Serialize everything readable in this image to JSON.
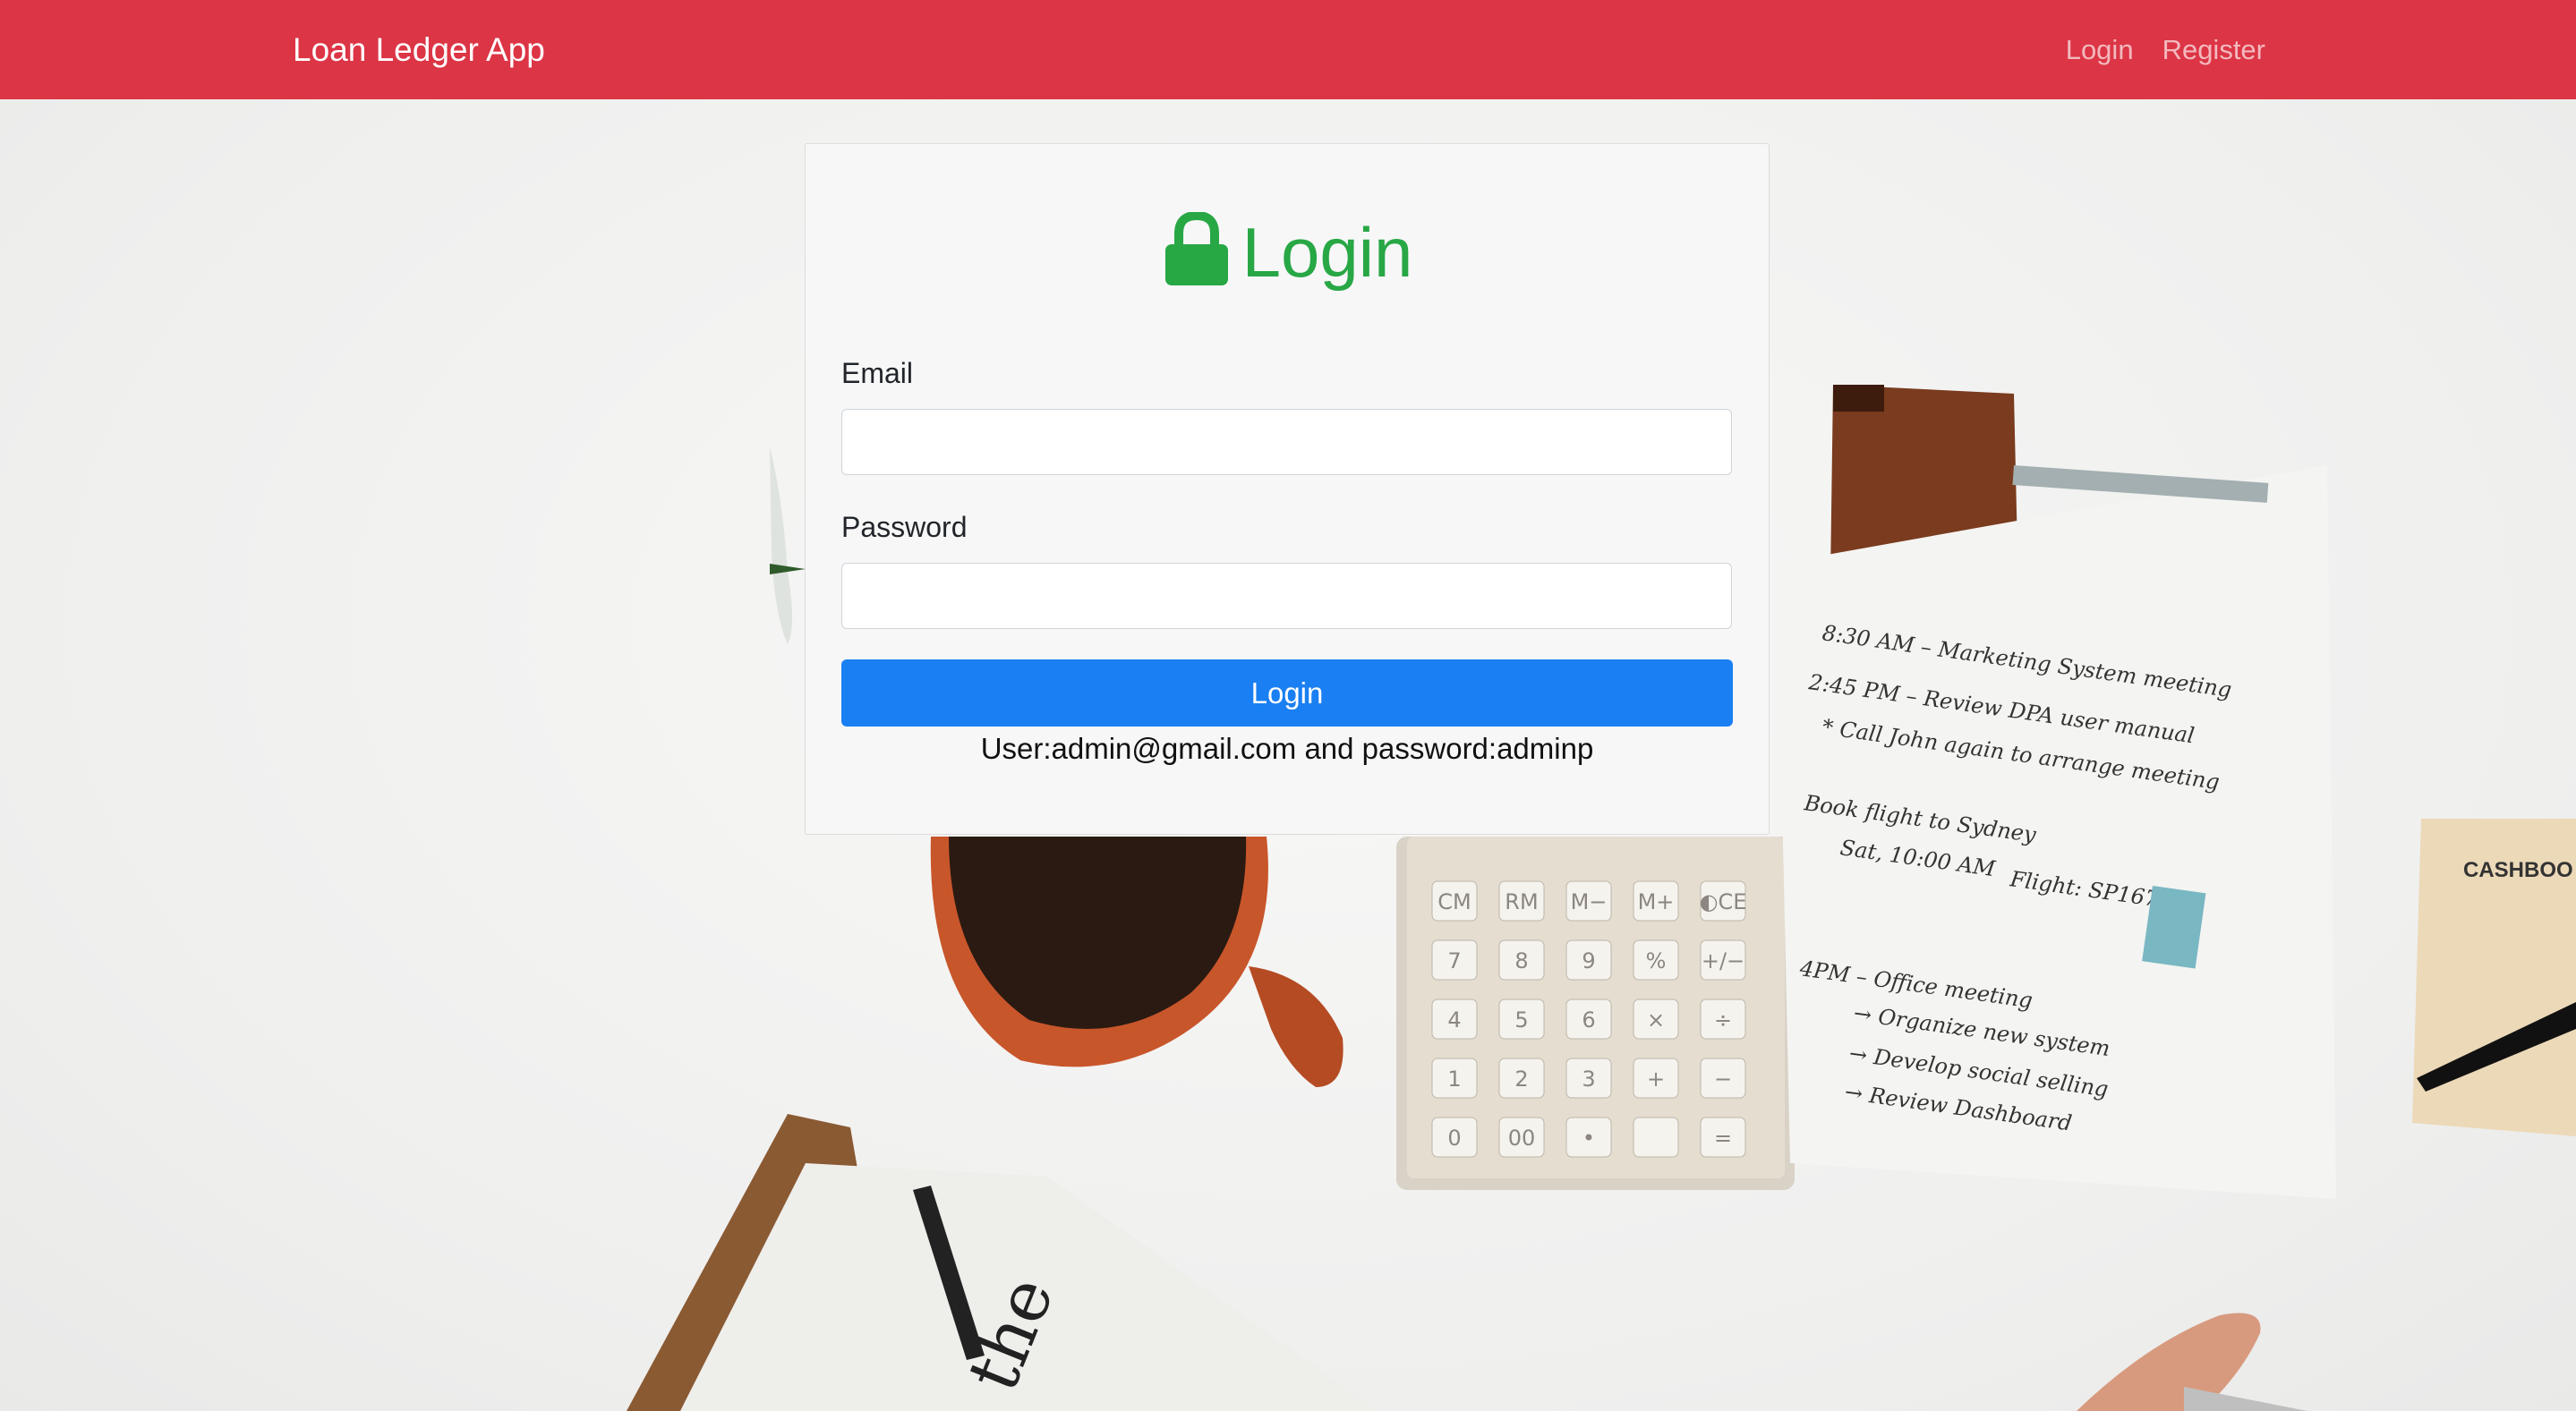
{
  "navbar": {
    "brand": "Loan Ledger App",
    "links": [
      {
        "label": "Login"
      },
      {
        "label": "Register"
      }
    ],
    "color": "#dc3545"
  },
  "login_card": {
    "title": "Login",
    "title_icon": "lock-icon",
    "title_color": "#28a745",
    "email": {
      "label": "Email",
      "value": "",
      "placeholder": ""
    },
    "password": {
      "label": "Password",
      "value": "",
      "placeholder": ""
    },
    "submit_label": "Login",
    "submit_color": "#1a7ff2",
    "hint": "User:admin@gmail.com and password:adminp"
  },
  "background": {
    "calculator_keys": [
      [
        "CM",
        "RM",
        "M−",
        "M+",
        "◐CE"
      ],
      [
        "7",
        "8",
        "9",
        "%",
        "+/−"
      ],
      [
        "4",
        "5",
        "6",
        "×",
        "÷"
      ],
      [
        "1",
        "2",
        "3",
        "+",
        "−"
      ],
      [
        "0",
        "00",
        "•",
        "",
        "="
      ]
    ],
    "notes": [
      "8:30 AM – Marketing System meeting",
      "2:45 PM – Review DPA user manual",
      "* Call John again to arrange meeting",
      "Book flight to Sydney",
      "Sat, 10:00 AM",
      "Flight: SP1675",
      "4PM – Office meeting",
      "→ Organize new system",
      "→ Develop social selling",
      "→ Review Dashboard"
    ],
    "cashbook_label": "CASHBOO",
    "newspaper_text": "the"
  }
}
